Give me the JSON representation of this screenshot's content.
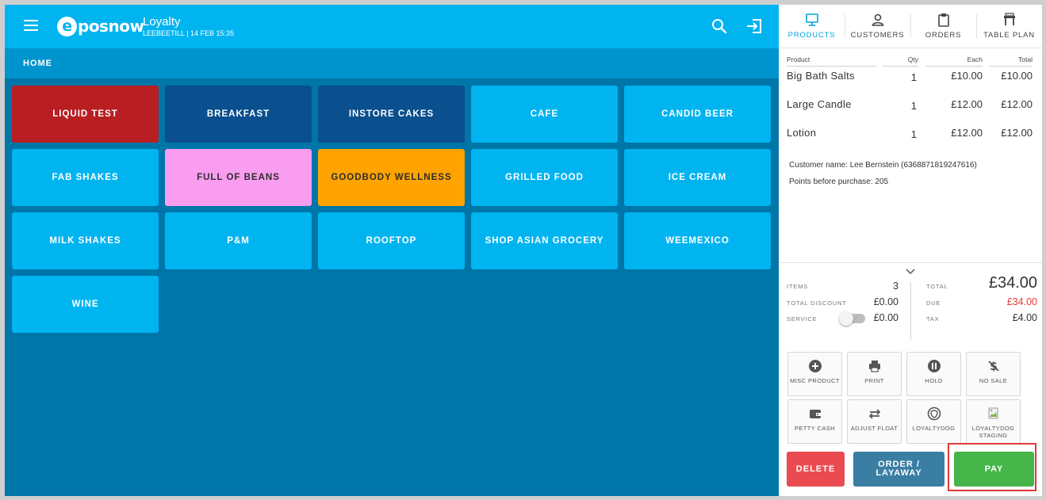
{
  "header": {
    "logo_letter": "e",
    "logo_text": "posnow",
    "title": "Loyalty",
    "subtitle": "LEEBEETILL | 14 FEB 15:35"
  },
  "breadcrumb": "HOME",
  "categories": [
    {
      "label": "LIQUID TEST",
      "color": "#b81e22",
      "text": "#ffffff"
    },
    {
      "label": "BREAKFAST",
      "color": "#0a4f8e",
      "text": "#ffffff"
    },
    {
      "label": "INSTORE CAKES",
      "color": "#0a4f8e",
      "text": "#ffffff"
    },
    {
      "label": "CAFE",
      "color": "#00b4f0",
      "text": "#ffffff"
    },
    {
      "label": "CANDID BEER",
      "color": "#00b4f0",
      "text": "#ffffff"
    },
    {
      "label": "FAB SHAKES",
      "color": "#00b4f0",
      "text": "#ffffff"
    },
    {
      "label": "FULL OF BEANS",
      "color": "#f99df0",
      "text": "#2d2d2d"
    },
    {
      "label": "GOODBODY WELLNESS",
      "color": "#ffa300",
      "text": "#2d2d2d"
    },
    {
      "label": "GRILLED FOOD",
      "color": "#00b4f0",
      "text": "#ffffff"
    },
    {
      "label": "ICE CREAM",
      "color": "#00b4f0",
      "text": "#ffffff"
    },
    {
      "label": "MILK SHAKES",
      "color": "#00b4f0",
      "text": "#ffffff"
    },
    {
      "label": "P&M",
      "color": "#00b4f0",
      "text": "#ffffff"
    },
    {
      "label": "ROOFTOP",
      "color": "#00b4f0",
      "text": "#ffffff"
    },
    {
      "label": "SHOP ASIAN GROCERY",
      "color": "#00b4f0",
      "text": "#ffffff"
    },
    {
      "label": "WEEMEXICO",
      "color": "#00b4f0",
      "text": "#ffffff"
    },
    {
      "label": "WINE",
      "color": "#00b4f0",
      "text": "#ffffff"
    }
  ],
  "side_tabs": [
    {
      "label": "PRODUCTS",
      "icon": "monitor-icon",
      "active": true
    },
    {
      "label": "CUSTOMERS",
      "icon": "person-icon",
      "active": false
    },
    {
      "label": "ORDERS",
      "icon": "clipboard-icon",
      "active": false
    },
    {
      "label": "TABLE PLAN",
      "icon": "table-icon",
      "active": false
    }
  ],
  "order": {
    "columns": {
      "product": "Product",
      "qty": "Qty",
      "each": "Each",
      "total": "Total"
    },
    "rows": [
      {
        "product": "Big Bath Salts",
        "qty": "1",
        "each": "£10.00",
        "total": "£10.00"
      },
      {
        "product": "Large Candle",
        "qty": "1",
        "each": "£12.00",
        "total": "£12.00"
      },
      {
        "product": "Lotion",
        "qty": "1",
        "each": "£12.00",
        "total": "£12.00"
      }
    ],
    "customer_name": "Customer name: Lee Bernstein (6368871819247616)",
    "points": "Points before purchase: 205"
  },
  "summary": {
    "items_label": "ITEMS",
    "items": "3",
    "discount_label": "TOTAL DISCOUNT",
    "discount": "£0.00",
    "service_label": "SERVICE",
    "service": "£0.00",
    "total_label": "TOTAL",
    "total": "£34.00",
    "due_label": "DUE",
    "due": "£34.00",
    "tax_label": "TAX",
    "tax": "£4.00",
    "due_color": "#e53935"
  },
  "actions": [
    {
      "label": "MISC PRODUCT",
      "icon": "plus-circle-icon"
    },
    {
      "label": "PRINT",
      "icon": "printer-icon"
    },
    {
      "label": "HOLD",
      "icon": "pause-circle-icon"
    },
    {
      "label": "NO SALE",
      "icon": "no-sale-icon"
    },
    {
      "label": "PETTY CASH",
      "icon": "wallet-icon"
    },
    {
      "label": "ADJUST FLOAT",
      "icon": "swap-icon"
    },
    {
      "label": "LOYALTYDOG",
      "icon": "loyaltydog-icon"
    },
    {
      "label": "LOYALTYDOG STAGING",
      "icon": "broken-image-icon"
    }
  ],
  "buttons": {
    "delete": "DELETE",
    "order_line1": "ORDER /",
    "order_line2": "LAYAWAY",
    "pay": "PAY"
  }
}
